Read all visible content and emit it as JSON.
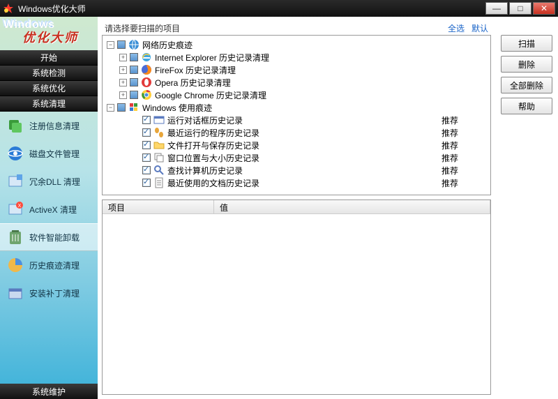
{
  "window": {
    "title": "Windows优化大师"
  },
  "window_controls": {
    "min": "—",
    "max": "□",
    "close": "✕"
  },
  "logo": {
    "line1": "Windows",
    "line2": "优化大师"
  },
  "nav_tabs": {
    "start": "开始",
    "detect": "系统检测",
    "optimize": "系统优化",
    "clean": "系统清理"
  },
  "nav_items": [
    {
      "label": "注册信息清理"
    },
    {
      "label": "磁盘文件管理"
    },
    {
      "label": "冗余DLL 清理"
    },
    {
      "label": "ActiveX 清理"
    },
    {
      "label": "软件智能卸载"
    },
    {
      "label": "历史痕迹清理"
    },
    {
      "label": "安装补丁清理"
    }
  ],
  "nav_bottom": "系统维护",
  "prompt": "请选择要扫描的项目",
  "links": {
    "select_all": "全选",
    "default": "默认"
  },
  "actions": {
    "scan": "扫描",
    "delete": "删除",
    "delete_all": "全部删除",
    "help": "帮助"
  },
  "tree": [
    {
      "indent": 0,
      "expand": "-",
      "check": "filled",
      "icon": "globe",
      "label": "网络历史痕迹",
      "rec": ""
    },
    {
      "indent": 1,
      "expand": "+",
      "check": "filled",
      "icon": "ie",
      "label": "Internet Explorer 历史记录清理",
      "rec": ""
    },
    {
      "indent": 1,
      "expand": "+",
      "check": "filled",
      "icon": "firefox",
      "label": "FireFox 历史记录清理",
      "rec": ""
    },
    {
      "indent": 1,
      "expand": "+",
      "check": "filled",
      "icon": "opera",
      "label": "Opera 历史记录清理",
      "rec": ""
    },
    {
      "indent": 1,
      "expand": "+",
      "check": "filled",
      "icon": "chrome",
      "label": "Google Chrome 历史记录清理",
      "rec": ""
    },
    {
      "indent": 0,
      "expand": "-",
      "check": "filled",
      "icon": "winflag",
      "label": "Windows 使用痕迹",
      "rec": ""
    },
    {
      "indent": 2,
      "expand": "",
      "check": "on",
      "icon": "dialog",
      "label": "运行对话框历史记录",
      "rec": "推荐"
    },
    {
      "indent": 2,
      "expand": "",
      "check": "on",
      "icon": "steps",
      "label": "最近运行的程序历史记录",
      "rec": "推荐"
    },
    {
      "indent": 2,
      "expand": "",
      "check": "on",
      "icon": "folder",
      "label": "文件打开与保存历史记录",
      "rec": "推荐"
    },
    {
      "indent": 2,
      "expand": "",
      "check": "on",
      "icon": "window",
      "label": "窗口位置与大小历史记录",
      "rec": "推荐"
    },
    {
      "indent": 2,
      "expand": "",
      "check": "on",
      "icon": "search",
      "label": "查找计算机历史记录",
      "rec": "推荐"
    },
    {
      "indent": 2,
      "expand": "",
      "check": "on",
      "icon": "doc",
      "label": "最近使用的文档历史记录",
      "rec": "推荐"
    }
  ],
  "columns": {
    "item": "项目",
    "value": "值"
  }
}
